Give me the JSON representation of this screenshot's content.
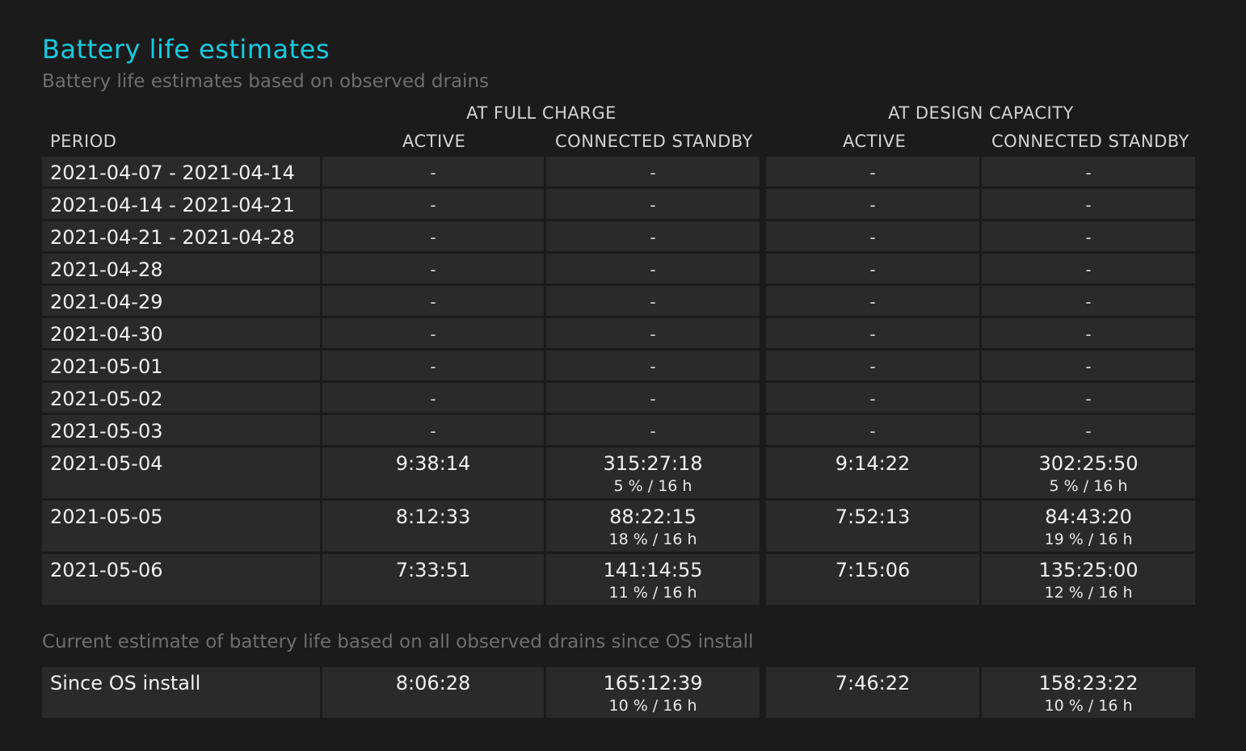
{
  "title": "Battery life estimates",
  "subtitle": "Battery life estimates based on observed drains",
  "group_headers": {
    "full_charge": "AT FULL CHARGE",
    "design_capacity": "AT DESIGN CAPACITY"
  },
  "column_headers": {
    "period": "PERIOD",
    "fc_active": "ACTIVE",
    "fc_standby": "CONNECTED STANDBY",
    "dc_active": "ACTIVE",
    "dc_standby": "CONNECTED STANDBY"
  },
  "rows": [
    {
      "period": "2021-04-07 - 2021-04-14",
      "fc_active": "-",
      "fc_standby": "-",
      "fc_standby_sub": "",
      "dc_active": "-",
      "dc_standby": "-",
      "dc_standby_sub": ""
    },
    {
      "period": "2021-04-14 - 2021-04-21",
      "fc_active": "-",
      "fc_standby": "-",
      "fc_standby_sub": "",
      "dc_active": "-",
      "dc_standby": "-",
      "dc_standby_sub": ""
    },
    {
      "period": "2021-04-21 - 2021-04-28",
      "fc_active": "-",
      "fc_standby": "-",
      "fc_standby_sub": "",
      "dc_active": "-",
      "dc_standby": "-",
      "dc_standby_sub": ""
    },
    {
      "period": "2021-04-28",
      "fc_active": "-",
      "fc_standby": "-",
      "fc_standby_sub": "",
      "dc_active": "-",
      "dc_standby": "-",
      "dc_standby_sub": ""
    },
    {
      "period": "2021-04-29",
      "fc_active": "-",
      "fc_standby": "-",
      "fc_standby_sub": "",
      "dc_active": "-",
      "dc_standby": "-",
      "dc_standby_sub": ""
    },
    {
      "period": "2021-04-30",
      "fc_active": "-",
      "fc_standby": "-",
      "fc_standby_sub": "",
      "dc_active": "-",
      "dc_standby": "-",
      "dc_standby_sub": ""
    },
    {
      "period": "2021-05-01",
      "fc_active": "-",
      "fc_standby": "-",
      "fc_standby_sub": "",
      "dc_active": "-",
      "dc_standby": "-",
      "dc_standby_sub": ""
    },
    {
      "period": "2021-05-02",
      "fc_active": "-",
      "fc_standby": "-",
      "fc_standby_sub": "",
      "dc_active": "-",
      "dc_standby": "-",
      "dc_standby_sub": ""
    },
    {
      "period": "2021-05-03",
      "fc_active": "-",
      "fc_standby": "-",
      "fc_standby_sub": "",
      "dc_active": "-",
      "dc_standby": "-",
      "dc_standby_sub": ""
    },
    {
      "period": "2021-05-04",
      "fc_active": "9:38:14",
      "fc_standby": "315:27:18",
      "fc_standby_sub": "5 % / 16 h",
      "dc_active": "9:14:22",
      "dc_standby": "302:25:50",
      "dc_standby_sub": "5 % / 16 h"
    },
    {
      "period": "2021-05-05",
      "fc_active": "8:12:33",
      "fc_standby": "88:22:15",
      "fc_standby_sub": "18 % / 16 h",
      "dc_active": "7:52:13",
      "dc_standby": "84:43:20",
      "dc_standby_sub": "19 % / 16 h"
    },
    {
      "period": "2021-05-06",
      "fc_active": "7:33:51",
      "fc_standby": "141:14:55",
      "fc_standby_sub": "11 % / 16 h",
      "dc_active": "7:15:06",
      "dc_standby": "135:25:00",
      "dc_standby_sub": "12 % / 16 h"
    }
  ],
  "since_install_note": "Current estimate of battery life based on all observed drains since OS install",
  "since_install": {
    "period": "Since OS install",
    "fc_active": "8:06:28",
    "fc_standby": "165:12:39",
    "fc_standby_sub": "10 % / 16 h",
    "dc_active": "7:46:22",
    "dc_standby": "158:23:22",
    "dc_standby_sub": "10 % / 16 h"
  }
}
